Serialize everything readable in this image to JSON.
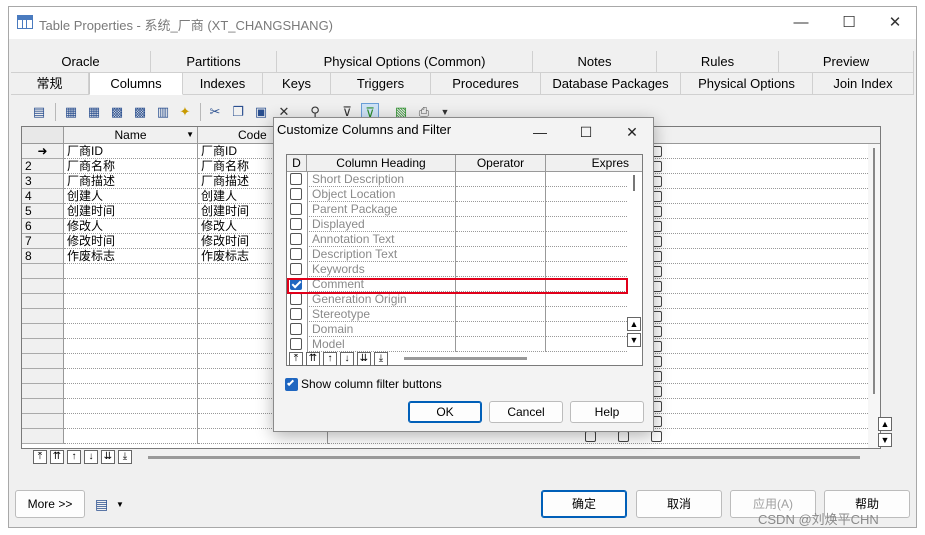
{
  "window": {
    "title": "Table Properties - 系统_厂商 (XT_CHANGSHANG)",
    "minimize": "—",
    "maximize": "☐",
    "close": "✕"
  },
  "tabs_row1": [
    {
      "label": "Oracle"
    },
    {
      "label": "Partitions"
    },
    {
      "label": "Physical Options (Common)"
    },
    {
      "label": "Notes"
    },
    {
      "label": "Rules"
    },
    {
      "label": "Preview"
    }
  ],
  "tabs_row2": [
    {
      "label": "常规"
    },
    {
      "label": "Columns",
      "active": true
    },
    {
      "label": "Indexes"
    },
    {
      "label": "Keys"
    },
    {
      "label": "Triggers"
    },
    {
      "label": "Procedures"
    },
    {
      "label": "Database Packages"
    },
    {
      "label": "Physical Options"
    },
    {
      "label": "Join Index"
    }
  ],
  "grid": {
    "columns": [
      "Name",
      "Code"
    ],
    "current_row_marker": "➜",
    "rows": [
      {
        "num": "",
        "name": "厂商ID",
        "code": "厂商ID"
      },
      {
        "num": "2",
        "name": "厂商名称",
        "code": "厂商名称"
      },
      {
        "num": "3",
        "name": "厂商描述",
        "code": "厂商描述"
      },
      {
        "num": "4",
        "name": "创建人",
        "code": "创建人"
      },
      {
        "num": "5",
        "name": "创建时间",
        "code": "创建时间"
      },
      {
        "num": "6",
        "name": "修改人",
        "code": "修改人"
      },
      {
        "num": "7",
        "name": "修改时间",
        "code": "修改时间"
      },
      {
        "num": "8",
        "name": "作废标志",
        "code": "作废标志"
      }
    ]
  },
  "nav_buttons": [
    "⤒",
    "⇈",
    "↑",
    "↓",
    "⇊",
    "⤓"
  ],
  "footer": {
    "more": "More >>",
    "ok": "确定",
    "cancel": "取消",
    "apply": "应用(A)",
    "help": "帮助"
  },
  "dialog": {
    "title": "Customize Columns and Filter",
    "minimize": "—",
    "maximize": "☐",
    "close": "✕",
    "headers": [
      "D",
      "Column Heading",
      "Operator",
      "Expres"
    ],
    "rows": [
      {
        "label": "Short Description",
        "checked": false
      },
      {
        "label": "Object Location",
        "checked": false
      },
      {
        "label": "Parent Package",
        "checked": false
      },
      {
        "label": "Displayed",
        "checked": false
      },
      {
        "label": "Annotation Text",
        "checked": false
      },
      {
        "label": "Description Text",
        "checked": false
      },
      {
        "label": "Keywords",
        "checked": false
      },
      {
        "label": "Comment",
        "checked": true
      },
      {
        "label": "Generation Origin",
        "checked": false
      },
      {
        "label": "Stereotype",
        "checked": false
      },
      {
        "label": "Domain",
        "checked": false
      },
      {
        "label": "Model",
        "checked": false
      }
    ],
    "show_filter_label": "Show column filter buttons",
    "show_filter_checked": true,
    "ok": "OK",
    "cancel": "Cancel",
    "help": "Help"
  },
  "watermark": "CSDN @刘焕平CHN"
}
